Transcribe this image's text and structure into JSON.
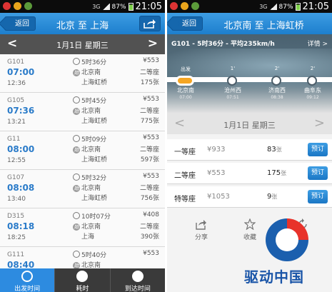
{
  "left": {
    "status": {
      "time": "21:05",
      "battery": "87%",
      "network": "3G"
    },
    "nav": {
      "back": "返回",
      "title": "北京 至 上海"
    },
    "date": {
      "label": "1月1日 星期三",
      "prev": "<",
      "next": ">"
    },
    "trains": [
      {
        "no": "G101",
        "dep": "07:00",
        "arr": "12:36",
        "dur": "5时36分",
        "from": "北京南",
        "to": "上海虹桥",
        "price": "¥553",
        "seat": "二等座",
        "left": "175张"
      },
      {
        "no": "G105",
        "dep": "07:36",
        "arr": "13:21",
        "dur": "5时45分",
        "from": "北京南",
        "to": "上海虹桥",
        "price": "¥553",
        "seat": "二等座",
        "left": "775张"
      },
      {
        "no": "G11",
        "dep": "08:00",
        "arr": "12:55",
        "dur": "5时09分",
        "from": "北京南",
        "to": "上海虹桥",
        "price": "¥553",
        "seat": "二等座",
        "left": "597张"
      },
      {
        "no": "G107",
        "dep": "08:08",
        "arr": "13:40",
        "dur": "5时32分",
        "from": "北京南",
        "to": "上海虹桥",
        "price": "¥553",
        "seat": "二等座",
        "left": "756张"
      },
      {
        "no": "D315",
        "dep": "08:18",
        "arr": "18:25",
        "dur": "10时07分",
        "from": "北京南",
        "to": "上海",
        "price": "¥408",
        "seat": "二等座",
        "left": "390张"
      },
      {
        "no": "G111",
        "dep": "08:40",
        "arr": "",
        "dur": "5时40分",
        "from": "北京南",
        "to": "",
        "price": "¥553",
        "seat": "",
        "left": ""
      }
    ],
    "tabs": [
      {
        "label": "出发时间",
        "active": true
      },
      {
        "label": "耗时",
        "active": false
      },
      {
        "label": "到达时间",
        "active": false
      }
    ]
  },
  "right": {
    "status": {
      "time": "21:05",
      "battery": "87%",
      "network": "3G"
    },
    "nav": {
      "back": "返回",
      "title": "北京南 至 上海虹桥"
    },
    "banner": {
      "title": "G101 - 5时36分 - 平均235km/h",
      "detail": "详情 >"
    },
    "stops": [
      {
        "name": "北京南",
        "time": "07:00",
        "mark": "出发"
      },
      {
        "name": "沧州西",
        "time": "07:51",
        "mark": "1'"
      },
      {
        "name": "济南西",
        "time": "08:38",
        "mark": "2'"
      },
      {
        "name": "曲阜东",
        "time": "09:12",
        "mark": "2'"
      }
    ],
    "date": {
      "label": "1月1日 星期三",
      "prev": "<",
      "next": ">"
    },
    "seats": [
      {
        "name": "一等座",
        "price": "¥933",
        "left": "83",
        "unit": "张",
        "btn": "预订"
      },
      {
        "name": "二等座",
        "price": "¥553",
        "left": "175",
        "unit": "张",
        "btn": "预订"
      },
      {
        "name": "特等座",
        "price": "¥1053",
        "left": "9",
        "unit": "张",
        "btn": "预订"
      }
    ],
    "actions": {
      "share": "分享",
      "fav": "收藏"
    },
    "watermark": "驱动中国"
  },
  "colors": {
    "accent": "#2d8be0",
    "time": "#2a7bc9",
    "navbar": "#1d7fcd"
  }
}
